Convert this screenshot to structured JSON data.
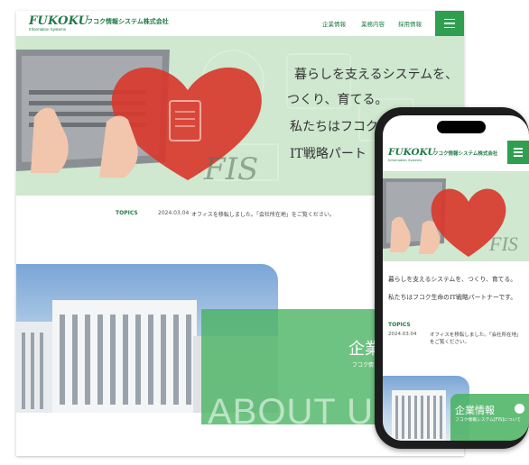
{
  "brand": {
    "logo": "FUKOKU",
    "name_ja": "フコク情報システム株式会社",
    "subtitle": "Information Systems"
  },
  "nav": {
    "items": [
      "企業情報",
      "業務内容",
      "採用情報"
    ]
  },
  "hero": {
    "tagline_lines": [
      "暮らしを支えるシステムを、",
      "つくり、育てる。",
      "私たちはフコク生",
      "IT戦略パート"
    ],
    "watermark": "FIS"
  },
  "topics": {
    "label": "TOPICS",
    "date": "2024.03.04",
    "text": "オフィスを移転しました。「会社所在地」をご覧ください。"
  },
  "about": {
    "title": "企業",
    "subtitle": "フコク情",
    "big_text": "ABOUT US"
  },
  "phone": {
    "tagline_lines": [
      "暮らしを支えるシステムを、つくり、育てる。",
      "私たちはフコク生命のIT戦略パートナーです。"
    ],
    "topics_label": "TOPICS",
    "topics_date": "2024.03.04",
    "topics_text": "オフィスを移転しました。「会社所在地」をご覧ください。",
    "about_title": "企業情報",
    "about_sub": "フコク情報システム[FIS]について"
  },
  "colors": {
    "brand_green": "#1f7a46",
    "accent_green": "#2f9f4f",
    "heart_red": "#d8382e",
    "hero_green": "#cfe8cf"
  }
}
